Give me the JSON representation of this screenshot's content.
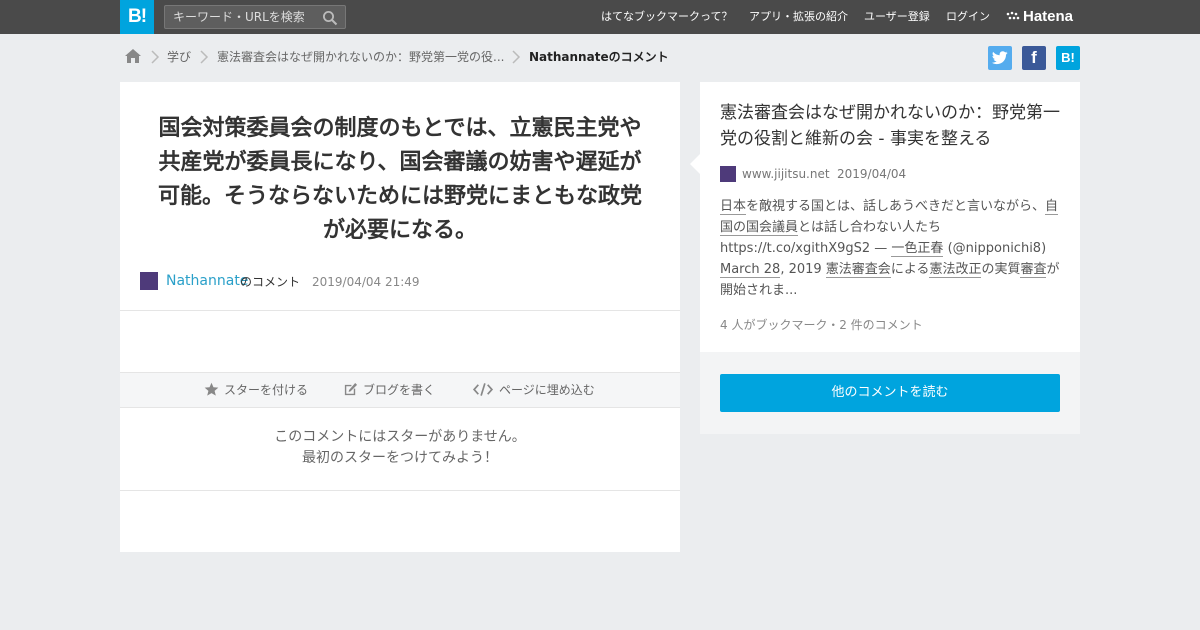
{
  "header": {
    "logo": "B!",
    "search_placeholder": "キーワード・URLを検索",
    "nav": [
      "はてなブックマークって？",
      "アプリ・拡張の紹介",
      "ユーザー登録",
      "ログイン"
    ],
    "brand": "Hatena"
  },
  "breadcrumb": {
    "items": [
      "学び",
      "憲法審査会はなぜ開かれないのか：野党第一党の役...",
      "Nathannateのコメント"
    ]
  },
  "share": {
    "twitter": "t",
    "facebook": "f",
    "hatena": "B!"
  },
  "comment": {
    "text": "国会対策委員会の制度のもとでは、立憲民主党や共産党が委員長になり、国会審議の妨害や遅延が可能。そうならないためには野党にまともな政党が必要になる。",
    "user": "Nathannate",
    "user_suffix": "のコメント",
    "date": "2019/04/04 21:49",
    "actions": {
      "star": "スターを付ける",
      "blog": "ブログを書く",
      "embed": "ページに埋め込む"
    },
    "no_star_line1": "このコメントにはスターがありません。",
    "no_star_line2": "最初のスターをつけてみよう！"
  },
  "entry": {
    "title": "憲法審査会はなぜ開かれないのか：野党第一党の役割と維新の会 - 事実を整える",
    "host": "www.jijitsu.net",
    "date": "2019/04/04",
    "summary": {
      "p1": "日本",
      "p2": "を敵視する国とは、話しあうべきだと言いながら、",
      "p3": "自国の国会議員",
      "p4": "とは話し合わない人たち https://t.co/xgithX9gS2 — ",
      "p5": "一色正春",
      "p6": " (@nipponichi8) ",
      "p7": "March 28",
      "p8": ", 2019 ",
      "p9": "憲法審査会",
      "p10": "による",
      "p11": "憲法改正",
      "p12": "の実質",
      "p13": "審査",
      "p14": "が開始されま..."
    },
    "stats": "4 人がブックマーク・2 件のコメント",
    "read_more": "他のコメントを読む"
  }
}
